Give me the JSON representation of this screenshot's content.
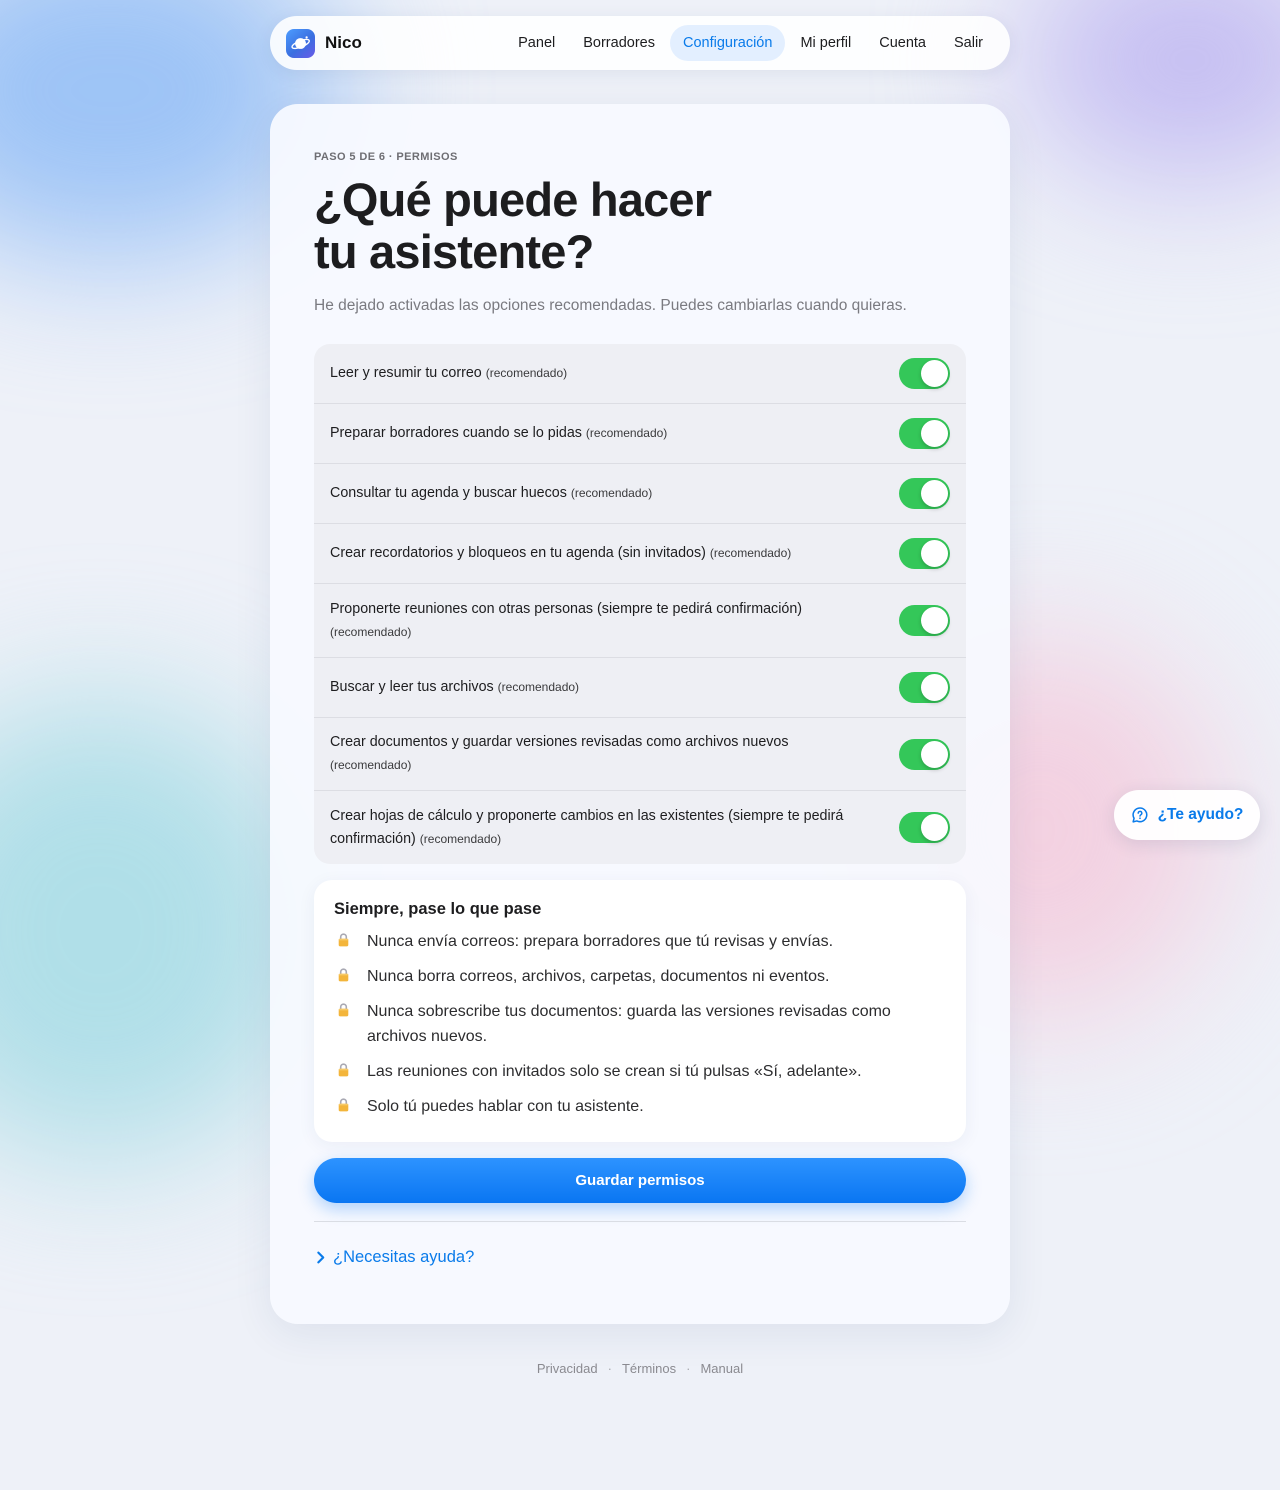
{
  "nav": {
    "brand": "Nico",
    "links": [
      "Panel",
      "Borradores",
      "Configuración",
      "Mi perfil",
      "Cuenta",
      "Salir"
    ],
    "active_link": "Configuración"
  },
  "card": {
    "step": "PASO 5 DE 6 · PERMISOS",
    "title_line1": "¿Qué puede hacer",
    "title_line2": "tu asistente?",
    "subtitle": "He dejado activadas las opciones recomendadas. Puedes cambiarlas cuando quieras."
  },
  "permissions": [
    {
      "text": "Leer y resumir tu correo",
      "tag": "(recomendado)",
      "enabled": true
    },
    {
      "text": "Preparar borradores cuando se lo pidas",
      "tag": "(recomendado)",
      "enabled": true
    },
    {
      "text": "Consultar tu agenda y buscar huecos",
      "tag": "(recomendado)",
      "enabled": true
    },
    {
      "text": "Crear recordatorios y bloqueos en tu agenda (sin invitados)",
      "tag": "(recomendado)",
      "enabled": true
    },
    {
      "text": "Proponerte reuniones con otras personas (siempre te pedirá confirmación)",
      "tag": "(recomendado)",
      "enabled": true
    },
    {
      "text": "Buscar y leer tus archivos",
      "tag": "(recomendado)",
      "enabled": true
    },
    {
      "text": "Crear documentos y guardar versiones revisadas como archivos nuevos",
      "tag": "(recomendado)",
      "enabled": true
    },
    {
      "text": "Crear hojas de cálculo y proponerte cambios en las existentes (siempre te pedirá confirmación)",
      "tag": "(recomendado)",
      "enabled": true
    }
  ],
  "always": {
    "title": "Siempre, pase lo que pase",
    "rules": [
      "Nunca envía correos: prepara borradores que tú revisas y envías.",
      "Nunca borra correos, archivos, carpetas, documentos ni eventos.",
      "Nunca sobrescribe tus documentos: guarda las versiones revisadas como archivos nuevos.",
      "Las reuniones con invitados solo se crean si tú pulsas «Sí, adelante».",
      "Solo tú puedes hablar con tu asistente."
    ]
  },
  "save_label": "Guardar permisos",
  "help_label": "¿Necesitas ayuda?",
  "footer": {
    "privacy": "Privacidad",
    "terms": "Términos",
    "manual": "Manual",
    "sep": "·"
  },
  "float_help": "¿Te ayudo?",
  "colors": {
    "accent": "#0a7bea",
    "toggle_on": "#34c759",
    "button": "#0a76f2"
  }
}
